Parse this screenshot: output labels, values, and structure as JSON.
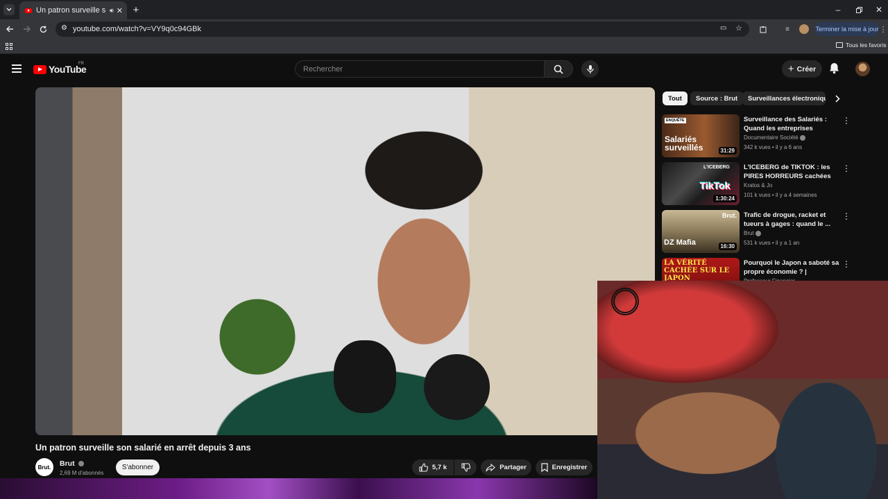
{
  "browser": {
    "tab_title": "Un patron surveille son salarié",
    "url": "youtube.com/watch?v=VY9q0c94GBk",
    "update_button": "Terminer la mise à jour",
    "bookmarks_all": "Tous les favoris"
  },
  "youtube": {
    "logo_text": "YouTube",
    "region": "FR",
    "search_placeholder": "Rechercher",
    "create_label": "Créer"
  },
  "video": {
    "title": "Un patron surveille son salarié en arrêt depuis 3 ans",
    "channel": "Brut",
    "channel_avatar_text": "Brut.",
    "subscribers": "2,69 M d'abonnés",
    "subscribe_label": "S'abonner",
    "likes": "5,7 k",
    "share_label": "Partager",
    "save_label": "Enregistrer"
  },
  "chips": [
    "Tout",
    "Source : Brut",
    "Surveillances électroniques"
  ],
  "recommendations": [
    {
      "title": "Surveillance des Salariés : Quand les entreprises utilisent...",
      "channel": "Documentaire Société",
      "meta": "342 k vues • il y a 6 ans",
      "duration": "31:29",
      "thumb_text": "Salariés surveillés",
      "thumb_badge": "ENQUÊTE",
      "thumb_color": "#7a3b20"
    },
    {
      "title": "L'ICEBERG de TIKTOK : les PIRES HORREURS cachées de...",
      "channel": "Kratos & Jo",
      "meta": "101 k vues • il y a 4 semaines",
      "duration": "1:30:24",
      "thumb_text": "TikTok",
      "thumb_badge": "L'ICEBERG",
      "thumb_color": "#2a2a2a"
    },
    {
      "title": "Trafic de drogue, racket et tueurs à gages : quand le ...",
      "channel": "Brut",
      "meta": "531 k vues • il y a 1 an",
      "duration": "16:30",
      "thumb_text": "DZ Mafia",
      "thumb_badge": "Brut.",
      "thumb_color": "#8a7a5a"
    },
    {
      "title": "Pourquoi le Japon a saboté sa propre économie ? | Profonde...",
      "channel": "Professeur Financier",
      "meta": "",
      "duration": "",
      "thumb_text": "LA VÉRITÉ CACHÉE SUR LE JAPON",
      "thumb_badge": "",
      "thumb_color": "#a01818"
    }
  ]
}
